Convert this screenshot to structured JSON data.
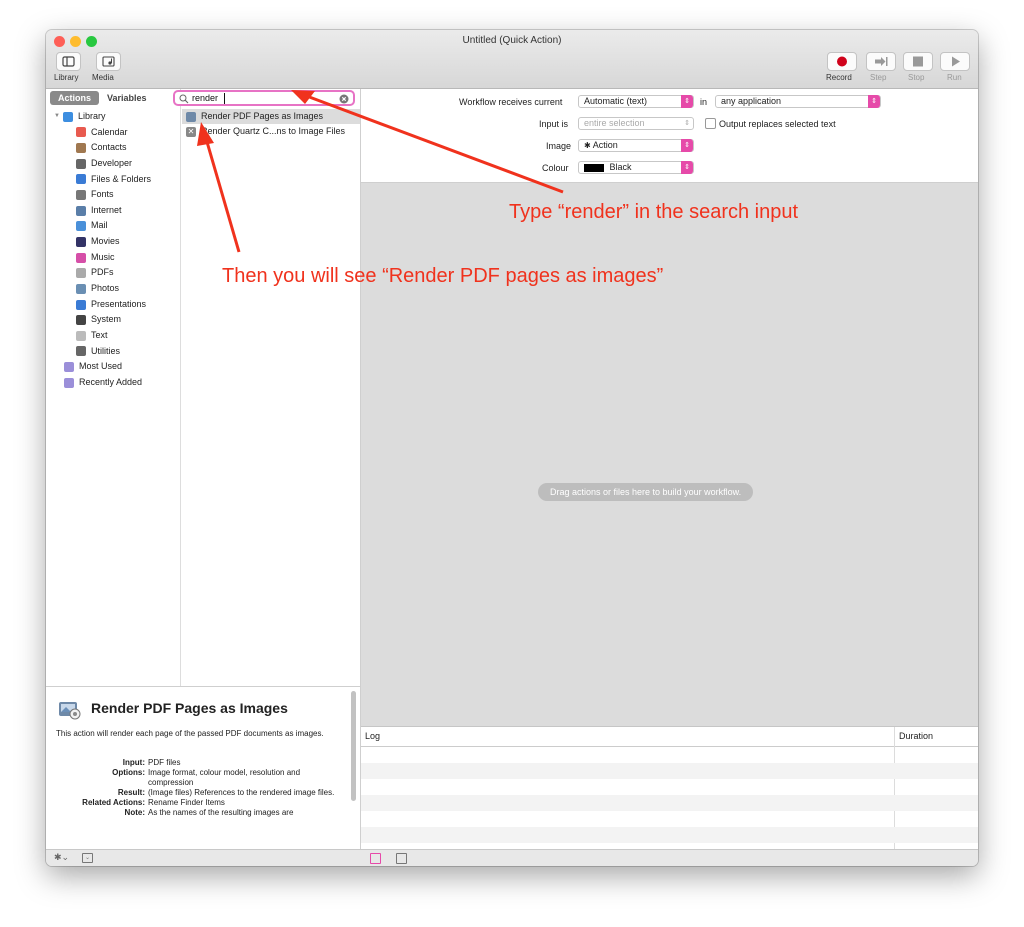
{
  "window": {
    "title": "Untitled (Quick Action)"
  },
  "toolbar": {
    "library": "Library",
    "media": "Media",
    "record": "Record",
    "step": "Step",
    "stop": "Stop",
    "run": "Run"
  },
  "sidebar": {
    "tab_actions": "Actions",
    "tab_variables": "Variables",
    "search_value": "render",
    "tree": [
      {
        "label": "Library",
        "icon": "library-icon",
        "color": "#3d8ee0"
      },
      {
        "label": "Calendar",
        "icon": "calendar-icon",
        "color": "#e85a4f"
      },
      {
        "label": "Contacts",
        "icon": "contacts-icon",
        "color": "#a07850"
      },
      {
        "label": "Developer",
        "icon": "developer-icon",
        "color": "#666666"
      },
      {
        "label": "Files & Folders",
        "icon": "finder-icon",
        "color": "#3a7bd5"
      },
      {
        "label": "Fonts",
        "icon": "fonts-icon",
        "color": "#777777"
      },
      {
        "label": "Internet",
        "icon": "internet-icon",
        "color": "#5a7ea8"
      },
      {
        "label": "Mail",
        "icon": "mail-icon",
        "color": "#4a90d9"
      },
      {
        "label": "Movies",
        "icon": "movies-icon",
        "color": "#333366"
      },
      {
        "label": "Music",
        "icon": "music-icon",
        "color": "#d64fa8"
      },
      {
        "label": "PDFs",
        "icon": "pdf-icon",
        "color": "#aaaaaa"
      },
      {
        "label": "Photos",
        "icon": "photos-icon",
        "color": "#6a8fb3"
      },
      {
        "label": "Presentations",
        "icon": "presentations-icon",
        "color": "#3a7bd5"
      },
      {
        "label": "System",
        "icon": "system-icon",
        "color": "#444444"
      },
      {
        "label": "Text",
        "icon": "text-icon",
        "color": "#bbbbbb"
      },
      {
        "label": "Utilities",
        "icon": "utilities-icon",
        "color": "#666666"
      },
      {
        "label": "Most Used",
        "icon": "smart-folder-icon",
        "color": "#9b8fd9"
      },
      {
        "label": "Recently Added",
        "icon": "smart-folder-icon",
        "color": "#9b8fd9"
      }
    ],
    "actions": [
      {
        "label": "Render PDF Pages as Images",
        "icon": "render-pdf-icon"
      },
      {
        "label": "Render Quartz C...ns to Image Files",
        "icon": "render-quartz-icon"
      }
    ]
  },
  "description": {
    "title": "Render PDF Pages as Images",
    "summary": "This action will render each page of the passed PDF documents as images.",
    "input_label": "Input:",
    "input_value": "PDF files",
    "options_label": "Options:",
    "options_value": "Image format, colour model, resolution and compression",
    "result_label": "Result:",
    "result_value": "(Image files) References to the rendered image files.",
    "related_label": "Related Actions:",
    "related_value": "Rename Finder Items",
    "note_label": "Note:",
    "note_value": "As the names of the resulting images are"
  },
  "workflow": {
    "receives_label": "Workflow receives current",
    "receives_value": "Automatic (text)",
    "in_label": "in",
    "in_value": "any application",
    "input_is_label": "Input is",
    "input_is_value": "entire selection",
    "output_replaces": "Output replaces selected text",
    "image_label": "Image",
    "image_value": "Action",
    "colour_label": "Colour",
    "colour_value": "Black",
    "colour_swatch": "#000000",
    "drop_hint": "Drag actions or files here to build your workflow."
  },
  "log": {
    "col_log": "Log",
    "col_duration": "Duration"
  },
  "annotations": {
    "search_hint": "Type “render” in the search input",
    "result_hint": "Then you will see “Render PDF pages as images”",
    "color": "#f0321d"
  },
  "colors": {
    "accent": "#e64aa9",
    "search_highlight": "#e773c5",
    "close": "#fe5f57",
    "minimize": "#febc2e",
    "zoom": "#28c840",
    "record": "#d0021b"
  }
}
